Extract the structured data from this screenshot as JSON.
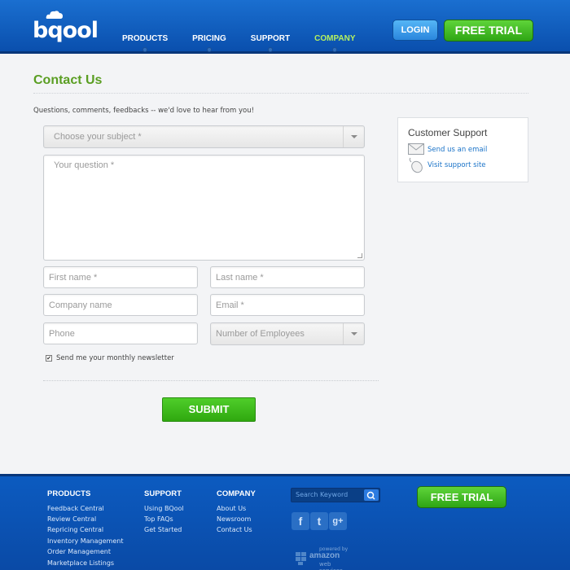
{
  "header": {
    "logo_text": "bqool",
    "nav": [
      {
        "label": "PRODUCTS"
      },
      {
        "label": "PRICING"
      },
      {
        "label": "SUPPORT"
      },
      {
        "label": "COMPANY"
      }
    ],
    "login_label": "LOGIN",
    "free_trial_label": "FREE TRIAL"
  },
  "main": {
    "title": "Contact Us",
    "intro": "Questions, comments, feedbacks -- we'd love to hear from you!",
    "form": {
      "subject_placeholder": "Choose your subject *",
      "question_placeholder": "Your question *",
      "first_name_placeholder": "First name *",
      "last_name_placeholder": "Last name *",
      "company_placeholder": "Company name",
      "email_placeholder": "Email *",
      "phone_placeholder": "Phone",
      "employees_placeholder": "Number of Employees",
      "newsletter_label": "Send me your monthly newsletter",
      "newsletter_checked": true,
      "submit_label": "SUBMIT"
    },
    "support": {
      "title": "Customer Support",
      "email_link": "Send us an email",
      "site_link": "Visit support site"
    }
  },
  "footer": {
    "products": {
      "heading": "PRODUCTS",
      "links": [
        "Feedback Central",
        "Review Central",
        "Repricing Central",
        "Inventory Management",
        "Order Management",
        "Marketplace Listings"
      ]
    },
    "support": {
      "heading": "SUPPORT",
      "links": [
        "Using BQool",
        "Top FAQs",
        "Get Started"
      ]
    },
    "company": {
      "heading": "COMPANY",
      "links": [
        "About Us",
        "Newsroom",
        "Contact Us"
      ]
    },
    "search_placeholder": "Search Keyword",
    "social": [
      {
        "icon": "facebook-icon",
        "glyph": "f"
      },
      {
        "icon": "twitter-icon",
        "glyph": "t"
      },
      {
        "icon": "google-plus-icon",
        "glyph": "g+"
      }
    ],
    "aws": {
      "small": "powered by",
      "brand": "amazon",
      "sub": "web services"
    },
    "free_trial_label": "FREE TRIAL"
  },
  "colors": {
    "header_blue": "#0a4fad",
    "accent_green": "#5a9e22",
    "button_green": "#2ea514",
    "link_blue": "#1a73c8"
  }
}
